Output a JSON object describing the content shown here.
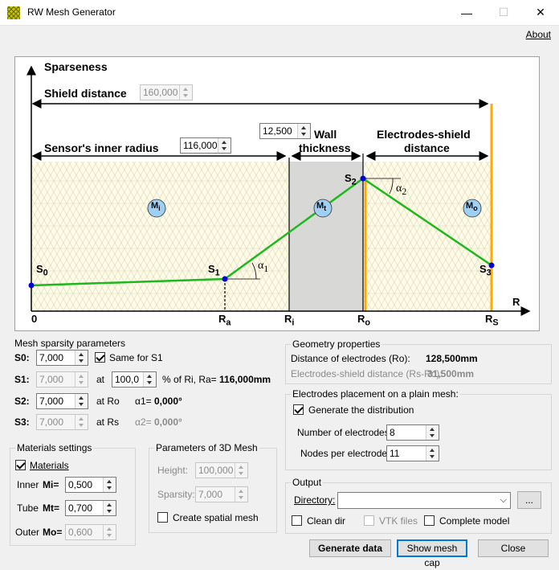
{
  "window": {
    "title": "RW Mesh Generator",
    "minimize": "—",
    "maximize": "☐",
    "close": "✕"
  },
  "menu": {
    "about": "About"
  },
  "diagram": {
    "sparseness": "Sparseness",
    "shield_distance_label": "Shield distance",
    "shield_distance_value": "160,000",
    "wall_value": "12,500",
    "wall_label_1": "Wall",
    "wall_label_2": "thickness",
    "es_label_1": "Electrodes-shield",
    "es_label_2": "distance",
    "inner_radius_label": "Sensor's inner radius",
    "inner_radius_value": "116,000",
    "axis_r": "R",
    "origin": "0",
    "ra": "R",
    "ra_sub": "a",
    "ri": "R",
    "ri_sub": "i",
    "ro": "R",
    "ro_sub": "o",
    "rs": "R",
    "rs_sub": "S",
    "s0": "S",
    "s0_sub": "0",
    "s1": "S",
    "s1_sub": "1",
    "s2": "S",
    "s2_sub": "2",
    "s3": "S",
    "s3_sub": "3",
    "mi": "M",
    "mi_sub": "i",
    "mt": "M",
    "mt_sub": "t",
    "mo": "M",
    "mo_sub": "o",
    "alpha1": "α",
    "alpha1_sub": "1",
    "alpha2": "α",
    "alpha2_sub": "2"
  },
  "sparsity": {
    "title": "Mesh sparsity parameters",
    "s0_label": "S0:",
    "s0_value": "7,000",
    "same_label": "Same for S1",
    "s1_label": "S1:",
    "s1_value": "7,000",
    "at1": "at",
    "pct_value": "100,0",
    "pct_text": "% of Ri, Ra=",
    "ra_value": "116,000mm",
    "s2_label": "S2:",
    "s2_value": "7,000",
    "at_ro": "at Ro",
    "alpha1_text": "α1=",
    "alpha1_value": "0,000°",
    "s3_label": "S3:",
    "s3_value": "7,000",
    "at_rs": "at Rs",
    "alpha2_text": "α2=",
    "alpha2_value": "0,000°"
  },
  "geometry": {
    "title": "Geometry properties",
    "ro_label": "Distance of electrodes (Ro):",
    "ro_value": "128,500mm",
    "es_label": "Electrodes-shield distance (Rs-Ro):",
    "es_value": "31,500mm"
  },
  "placement": {
    "title": "Electrodes placement on a plain mesh:",
    "gen_label": "Generate the distribution",
    "num_label": "Number of electrodes:",
    "num_value": "8",
    "nodes_label": "Nodes per electrode:",
    "nodes_value": "11"
  },
  "materials": {
    "title": "Materials settings",
    "materials_label": "Materials",
    "inner_label": "Inner",
    "mi_label": "Mi=",
    "mi_value": "0,500",
    "tube_label": "Tube",
    "mt_label": "Mt=",
    "mt_value": "0,700",
    "outer_label": "Outer",
    "mo_label": "Mo=",
    "mo_value": "0,600"
  },
  "mesh3d": {
    "title": "Parameters of 3D Mesh",
    "height_label": "Height:",
    "height_value": "100,000",
    "sparsity_label": "Sparsity:",
    "sparsity_value": "7,000",
    "spatial_label": "Create spatial mesh"
  },
  "output": {
    "title": "Output",
    "directory_label": "Directory:",
    "directory_value": "",
    "browse": "...",
    "clean_label": "Clean dir",
    "vtk_label": "VTK files",
    "complete_label": "Complete model"
  },
  "buttons": {
    "generate": "Generate data",
    "show": "Show mesh cap",
    "close": "Close"
  }
}
